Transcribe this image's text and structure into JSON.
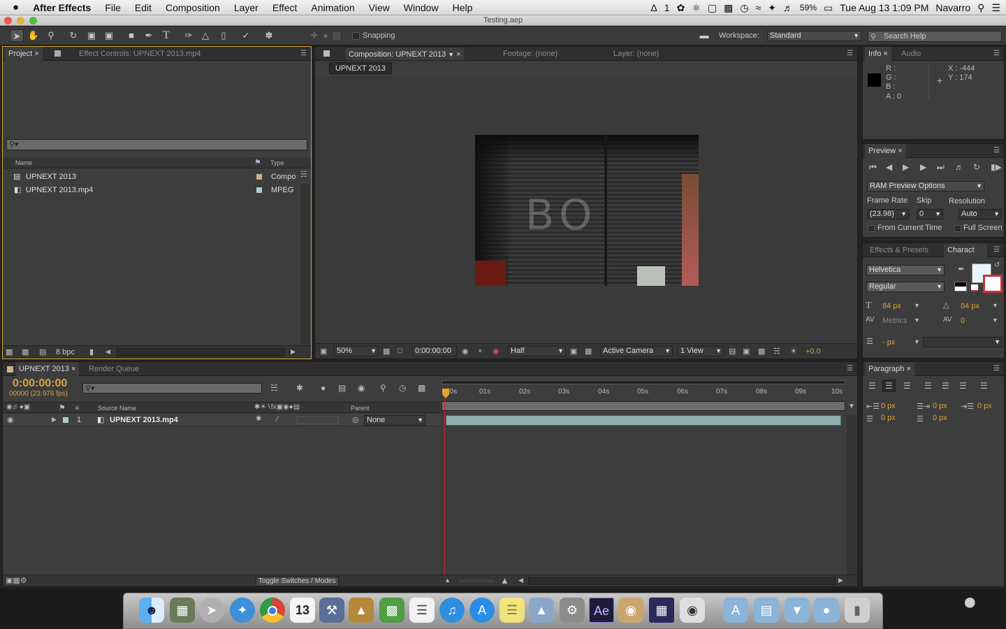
{
  "menubar": {
    "apple": "",
    "app": "After Effects",
    "items": [
      "File",
      "Edit",
      "Composition",
      "Layer",
      "Effect",
      "Animation",
      "View",
      "Window",
      "Help"
    ],
    "ai_badge": "1",
    "battery": "59%",
    "datetime": "Tue Aug 13  1:09 PM",
    "user": "Navarro"
  },
  "window": {
    "title": "Testing.aep"
  },
  "toolbar": {
    "snapping": "Snapping",
    "workspace_label": "Workspace:",
    "workspace_value": "Standard",
    "search_placeholder": "Search Help"
  },
  "project": {
    "tab_project": "Project",
    "tab_effect": "Effect Controls: UPNEXT 2013.mp4",
    "col_name": "Name",
    "col_type": "Type",
    "items": [
      {
        "name": "UPNEXT 2013",
        "type": "Compo",
        "swatch": "#c9b38a"
      },
      {
        "name": "UPNEXT 2013.mp4",
        "type": "MPEG",
        "swatch": "#a9cfd2"
      }
    ],
    "bpc": "8 bpc"
  },
  "comp": {
    "tab_comp": "Composition: UPNEXT 2013",
    "tab_footage": "Footage: (none)",
    "tab_layer": "Layer: (none)",
    "chip": "UPNEXT 2013",
    "zoom": "50%",
    "timecode": "0:00:00:00",
    "resolution": "Half",
    "camera": "Active Camera",
    "views": "1 View",
    "exposure": "+0.0",
    "frame_text": "BO"
  },
  "info": {
    "tab_info": "Info",
    "tab_audio": "Audio",
    "r": "R :",
    "g": "G :",
    "b": "B :",
    "a": "A : 0",
    "x": "X : -444",
    "y": "Y : 174"
  },
  "preview": {
    "tab": "Preview",
    "ram": "RAM Preview Options",
    "frame_rate_label": "Frame Rate",
    "skip_label": "Skip",
    "resolution_label": "Resolution",
    "frame_rate": "(23.98)",
    "skip": "0",
    "resolution": "Auto",
    "from_current": "From Current Time",
    "full_screen": "Full Screen"
  },
  "character": {
    "tab_effects": "Effects & Presets",
    "tab_char": "Charact",
    "font": "Helvetica",
    "style": "Regular",
    "size": "84 px",
    "leading": "84 px",
    "kerning": "Metrics",
    "tracking": "0",
    "stroke": "- px"
  },
  "timeline": {
    "tab": "UPNEXT 2013",
    "tab_rq": "Render Queue",
    "timecode": "0:00:00:00",
    "frames": "00000 (23.976 fps)",
    "col_num": "#",
    "col_source": "Source Name",
    "col_parent": "Parent",
    "layer": {
      "num": "1",
      "name": "UPNEXT 2013.mp4",
      "parent": "None"
    },
    "ruler": [
      "00s",
      "01s",
      "02s",
      "03s",
      "04s",
      "05s",
      "06s",
      "07s",
      "08s",
      "09s",
      "10s"
    ],
    "toggle": "Toggle Switches / Modes"
  },
  "paragraph": {
    "tab": "Paragraph",
    "v1": "0 px",
    "v2": "0 px",
    "v3": "0 px",
    "v4": "0 px",
    "v5": "0 px"
  },
  "dock": {
    "items": [
      "Finder",
      "iPhoto",
      "Launchpad",
      "Safari",
      "Chrome",
      "Calendar",
      "Xcode",
      "Keynote",
      "Numbers",
      "Reminders",
      "iTunes",
      "App Store",
      "Stickies",
      "Preview",
      "System Preferences",
      "Ae",
      "Image Capture",
      "Premiere",
      "Camera",
      "Folder",
      "Folder",
      "Folder",
      "Folder",
      "Trash"
    ],
    "calendar_day": "13",
    "ae": "Ae"
  }
}
